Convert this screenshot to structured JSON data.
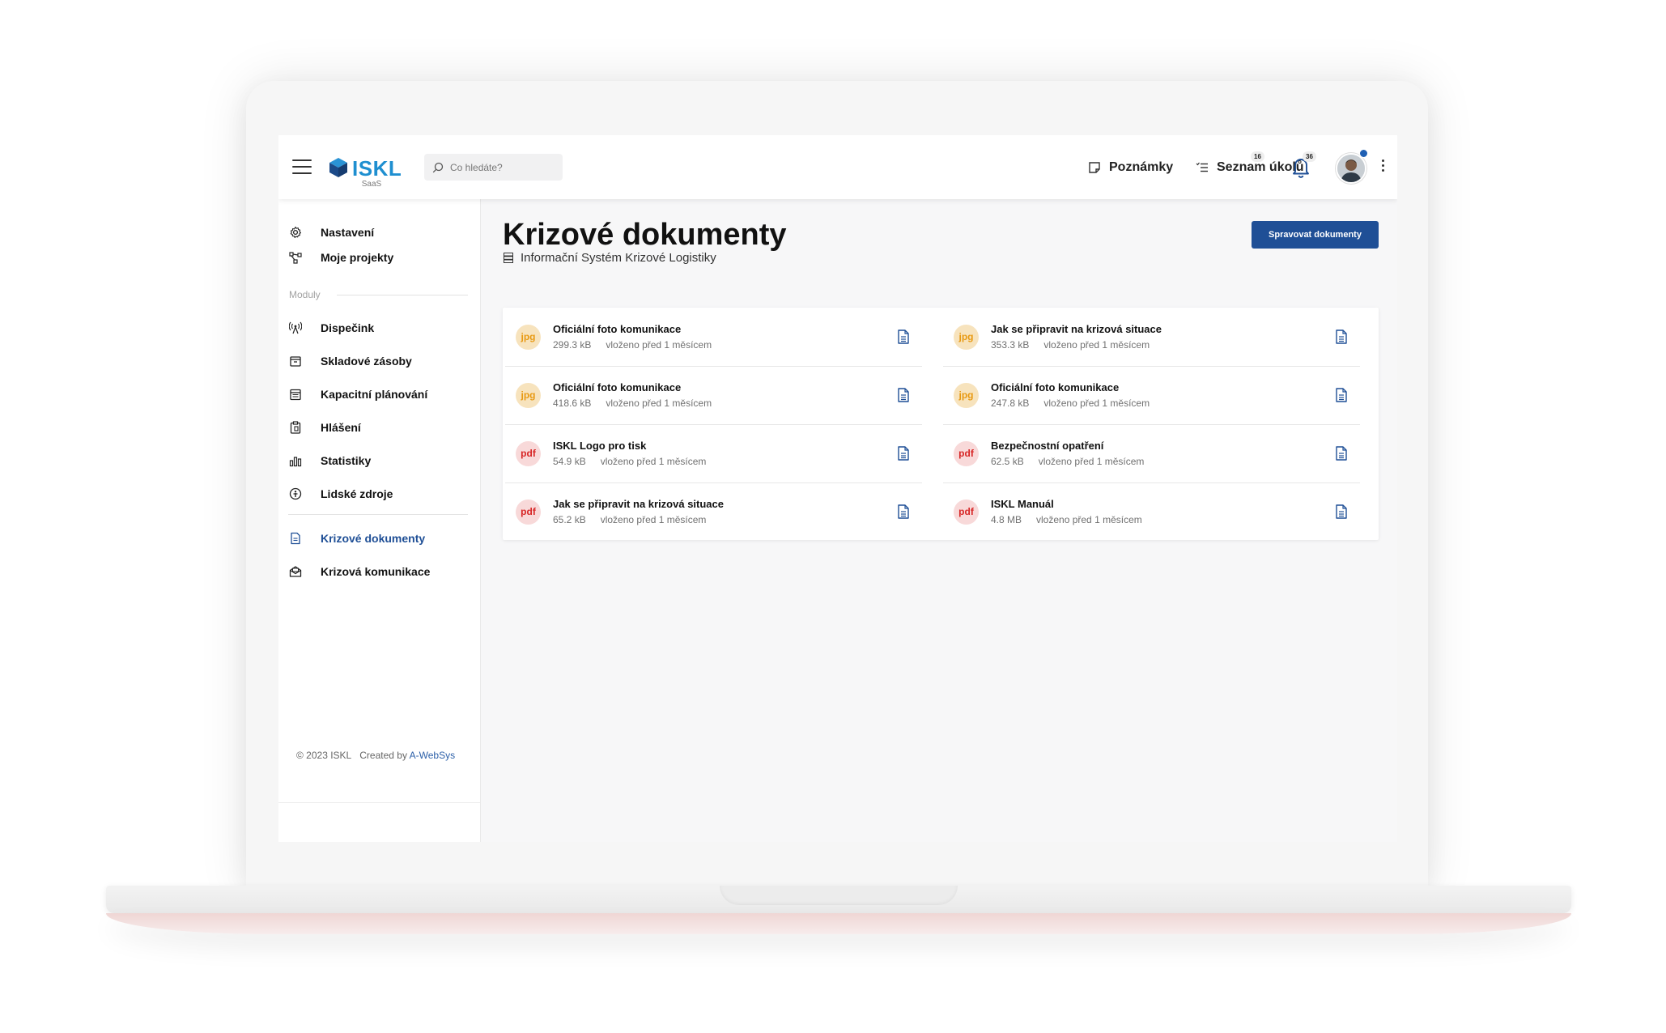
{
  "app": {
    "logo_text": "ISKL",
    "logo_sub": "SaaS"
  },
  "search": {
    "placeholder": "Co hledáte?"
  },
  "topbar": {
    "notes_label": "Poznámky",
    "tasks_label": "Seznam úkolů",
    "tasks_count": "16",
    "notifications_count": "36"
  },
  "sidebar": {
    "items": [
      {
        "label": "Nastavení",
        "icon": "gear-icon"
      },
      {
        "label": "Moje projekty",
        "icon": "project-network-icon"
      }
    ],
    "section_label": "Moduly",
    "modules": [
      {
        "label": "Dispečink",
        "icon": "antenna-icon"
      },
      {
        "label": "Skladové zásoby",
        "icon": "box-icon"
      },
      {
        "label": "Kapacitní plánování",
        "icon": "calendar-icon"
      },
      {
        "label": "Hlášení",
        "icon": "clipboard-icon"
      },
      {
        "label": "Statistiky",
        "icon": "bar-chart-icon"
      },
      {
        "label": "Lidské zdroje",
        "icon": "person-circle-icon"
      }
    ],
    "crisis": [
      {
        "label": "Krizové dokumenty",
        "icon": "document-icon",
        "active": true
      },
      {
        "label": "Krizová komunikace",
        "icon": "envelope-icon",
        "active": false
      }
    ],
    "footer": {
      "copyright": "© 2023 ISKL",
      "created_by": "Created by",
      "author_link": "A-WebSys"
    }
  },
  "main": {
    "title": "Krizové dokumenty",
    "subtitle": "Informační Systém Krizové Logistiky",
    "manage_button": "Spravovat dokumenty",
    "documents": [
      {
        "type": "jpg",
        "name": "Oficiální foto komunikace",
        "size": "299.3 kB",
        "uploaded": "vloženo před 1 měsícem"
      },
      {
        "type": "jpg",
        "name": "Jak se připravit na krizová situace",
        "size": "353.3 kB",
        "uploaded": "vloženo před 1 měsícem"
      },
      {
        "type": "jpg",
        "name": "Oficiální foto komunikace",
        "size": "418.6 kB",
        "uploaded": "vloženo před 1 měsícem"
      },
      {
        "type": "jpg",
        "name": "Oficiální foto komunikace",
        "size": "247.8 kB",
        "uploaded": "vloženo před 1 měsícem"
      },
      {
        "type": "pdf",
        "name": "ISKL Logo pro tisk",
        "size": "54.9 kB",
        "uploaded": "vloženo před 1 měsícem"
      },
      {
        "type": "pdf",
        "name": "Bezpečnostní opatření",
        "size": "62.5 kB",
        "uploaded": "vloženo před 1 měsícem"
      },
      {
        "type": "pdf",
        "name": "Jak se připravit na krizová situace",
        "size": "65.2 kB",
        "uploaded": "vloženo před 1 měsícem"
      },
      {
        "type": "pdf",
        "name": "ISKL Manuál",
        "size": "4.8 MB",
        "uploaded": "vloženo před 1 měsícem"
      }
    ]
  },
  "colors": {
    "primary": "#1f4f96",
    "logo_blue": "#1f8fd0",
    "jpg_badge_bg": "#f7e3bd",
    "jpg_badge_text": "#e89a14",
    "pdf_badge_bg": "#f8d9d9",
    "pdf_badge_text": "#d72626"
  }
}
